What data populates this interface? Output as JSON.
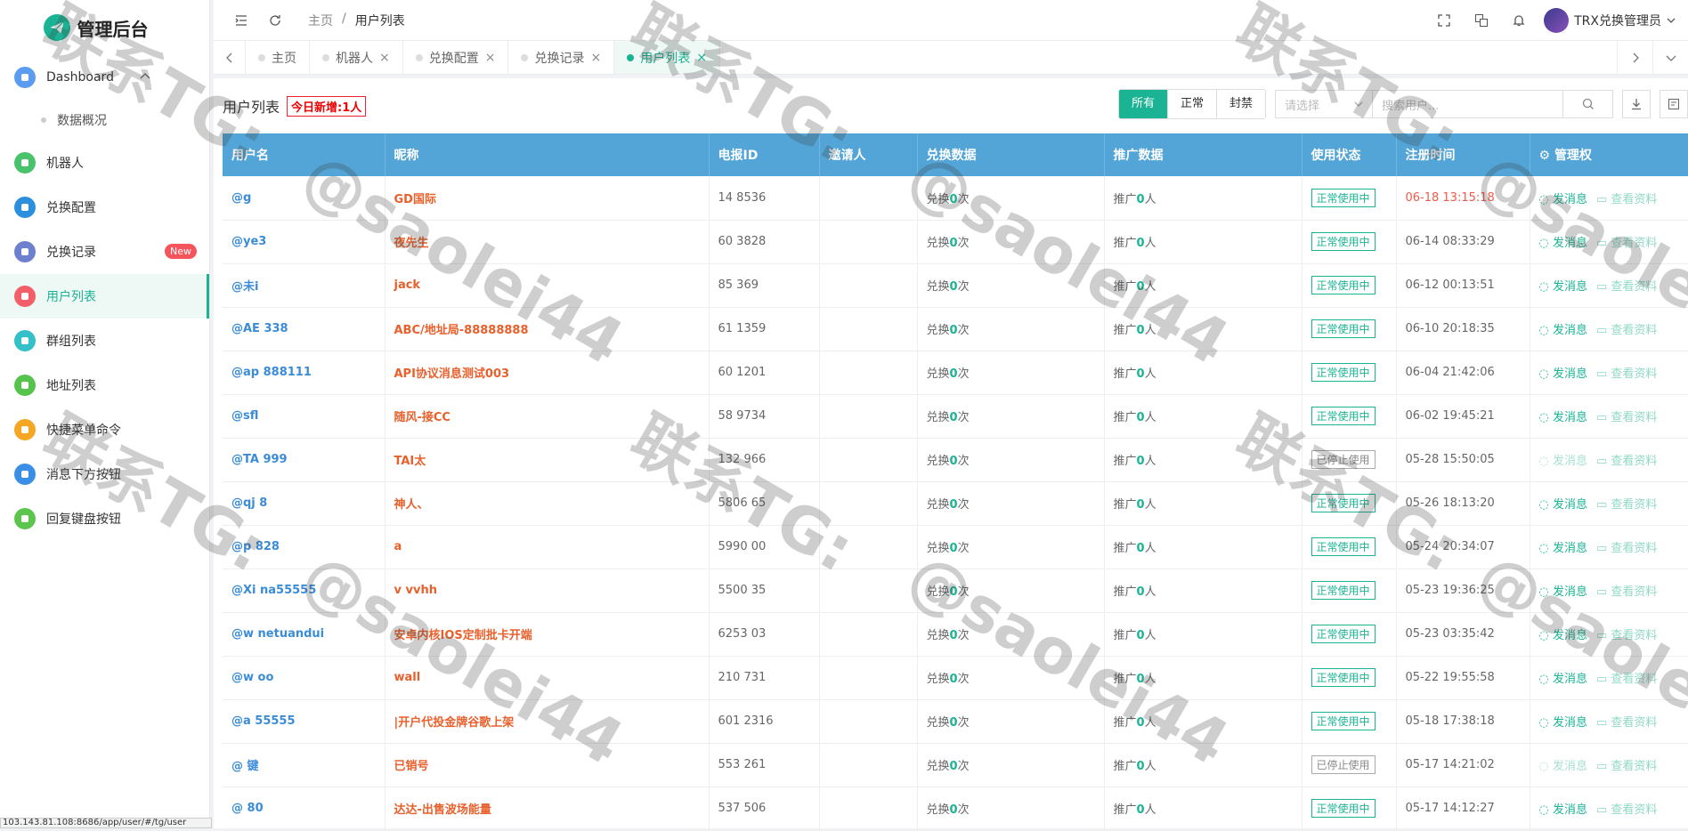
{
  "brand": {
    "title": "管理后台"
  },
  "sidebar": {
    "items": [
      {
        "label": "Dashboard",
        "color": "#5b9bf0",
        "icon": "home-icon",
        "active": false,
        "sub": [
          "数据概况"
        ]
      },
      {
        "label": "机器人",
        "color": "#49c26b",
        "icon": "monitor-icon",
        "active": false
      },
      {
        "label": "兑换配置",
        "color": "#2b8fde",
        "icon": "settings-icon",
        "active": false
      },
      {
        "label": "兑换记录",
        "color": "#6d7fcf",
        "icon": "document-icon",
        "active": false,
        "badge": "New"
      },
      {
        "label": "用户列表",
        "color": "#f25f68",
        "icon": "user-icon",
        "active": true
      },
      {
        "label": "群组列表",
        "color": "#33c0c8",
        "icon": "group-icon",
        "active": false
      },
      {
        "label": "地址列表",
        "color": "#56c44c",
        "icon": "cube-icon",
        "active": false
      },
      {
        "label": "快捷菜单命令",
        "color": "#f5a623",
        "icon": "sliders-icon",
        "active": false
      },
      {
        "label": "消息下方按钮",
        "color": "#3a8ee6",
        "icon": "button-icon",
        "active": false
      },
      {
        "label": "回复键盘按钮",
        "color": "#5cc54e",
        "icon": "keyboard-icon",
        "active": false
      }
    ]
  },
  "header": {
    "breadcrumb": [
      "主页",
      "用户列表"
    ],
    "user": "TRX兑换管理员"
  },
  "tabs": [
    {
      "label": "主页",
      "active": false,
      "closable": false
    },
    {
      "label": "机器人",
      "active": false,
      "closable": true
    },
    {
      "label": "兑换配置",
      "active": false,
      "closable": true
    },
    {
      "label": "兑换记录",
      "active": false,
      "closable": true
    },
    {
      "label": "用户列表",
      "active": true,
      "closable": true
    }
  ],
  "main": {
    "title": "用户列表",
    "today": "今日新增:1人",
    "filters": [
      "所有",
      "正常",
      "封禁"
    ],
    "select_placeholder": "请选择",
    "search_placeholder": "搜索用户...",
    "columns": [
      "用户名",
      "昵称",
      "电报ID",
      "邀请人",
      "兑换数据",
      "推广数据",
      "使用状态",
      "注册时间",
      "管理权"
    ],
    "manage_header": "管理权",
    "exchange_prefix": "兑换",
    "exchange_suffix": "次",
    "promo_prefix": "推广",
    "promo_suffix": "人",
    "action_msg": "发消息",
    "action_profile": "查看资料",
    "rows": [
      {
        "username": "@g",
        "nickname": "GD国际",
        "tgid": "14 8536",
        "inviter": "",
        "exchange": "0",
        "promo": "0",
        "status": "正常使用中",
        "stopped": false,
        "time": "06-18 13:15:18",
        "recent": true
      },
      {
        "username": "@ye3",
        "nickname": "夜先生",
        "tgid": "60 3828",
        "inviter": "",
        "exchange": "0",
        "promo": "0",
        "status": "正常使用中",
        "stopped": false,
        "time": "06-14 08:33:29",
        "recent": false
      },
      {
        "username": "@未i",
        "nickname": "jack",
        "tgid": "85 369",
        "inviter": "",
        "exchange": "0",
        "promo": "0",
        "status": "正常使用中",
        "stopped": false,
        "time": "06-12 00:13:51",
        "recent": false
      },
      {
        "username": "@AE 338",
        "nickname": "ABC/地址局-88888888",
        "tgid": "61 1359",
        "inviter": "",
        "exchange": "0",
        "promo": "0",
        "status": "正常使用中",
        "stopped": false,
        "time": "06-10 20:18:35",
        "recent": false
      },
      {
        "username": "@ap 888111",
        "nickname": "API协议消息测试003",
        "tgid": "60 1201",
        "inviter": "",
        "exchange": "0",
        "promo": "0",
        "status": "正常使用中",
        "stopped": false,
        "time": "06-04 21:42:06",
        "recent": false
      },
      {
        "username": "@sfl",
        "nickname": "随风-接CC",
        "tgid": "58 9734",
        "inviter": "",
        "exchange": "0",
        "promo": "0",
        "status": "正常使用中",
        "stopped": false,
        "time": "06-02 19:45:21",
        "recent": false
      },
      {
        "username": "@TA 999",
        "nickname": "TAI太",
        "tgid": "132 966",
        "inviter": "",
        "exchange": "0",
        "promo": "0",
        "status": "已停止使用",
        "stopped": true,
        "time": "05-28 15:50:05",
        "recent": false
      },
      {
        "username": "@qj 8",
        "nickname": "神人、",
        "tgid": "5806 65",
        "inviter": "",
        "exchange": "0",
        "promo": "0",
        "status": "正常使用中",
        "stopped": false,
        "time": "05-26 18:13:20",
        "recent": false
      },
      {
        "username": "@p 828",
        "nickname": "a",
        "tgid": "5990 00",
        "inviter": "",
        "exchange": "0",
        "promo": "0",
        "status": "正常使用中",
        "stopped": false,
        "time": "05-24 20:34:07",
        "recent": false
      },
      {
        "username": "@Xi na55555",
        "nickname": "v vvhh",
        "tgid": "5500 35",
        "inviter": "",
        "exchange": "0",
        "promo": "0",
        "status": "正常使用中",
        "stopped": false,
        "time": "05-23 19:36:25",
        "recent": false
      },
      {
        "username": "@w netuandui",
        "nickname": "安卓内核IOS定制批卡开端",
        "tgid": "6253 03",
        "inviter": "",
        "exchange": "0",
        "promo": "0",
        "status": "正常使用中",
        "stopped": false,
        "time": "05-23 03:35:42",
        "recent": false
      },
      {
        "username": "@w oo",
        "nickname": "wall",
        "tgid": "210 731",
        "inviter": "",
        "exchange": "0",
        "promo": "0",
        "status": "正常使用中",
        "stopped": false,
        "time": "05-22 19:55:58",
        "recent": false
      },
      {
        "username": "@a 55555",
        "nickname": "|开户代投金牌谷歌上架",
        "tgid": "601 2316",
        "inviter": "",
        "exchange": "0",
        "promo": "0",
        "status": "正常使用中",
        "stopped": false,
        "time": "05-18 17:38:18",
        "recent": false
      },
      {
        "username": "@ 键",
        "nickname": "已销号",
        "tgid": "553 261",
        "inviter": "",
        "exchange": "0",
        "promo": "0",
        "status": "已停止使用",
        "stopped": true,
        "time": "05-17 14:21:02",
        "recent": false
      },
      {
        "username": "@ 80",
        "nickname": "达达-出售波场能量",
        "tgid": "537 506",
        "inviter": "",
        "exchange": "0",
        "promo": "0",
        "status": "正常使用中",
        "stopped": false,
        "time": "05-17 14:12:27",
        "recent": false
      }
    ]
  },
  "statusbar": {
    "url": "103.143.81.108:8686/app/user/#/tg/user"
  },
  "watermarks": [
    "联系TG:",
    "@saolei44"
  ]
}
